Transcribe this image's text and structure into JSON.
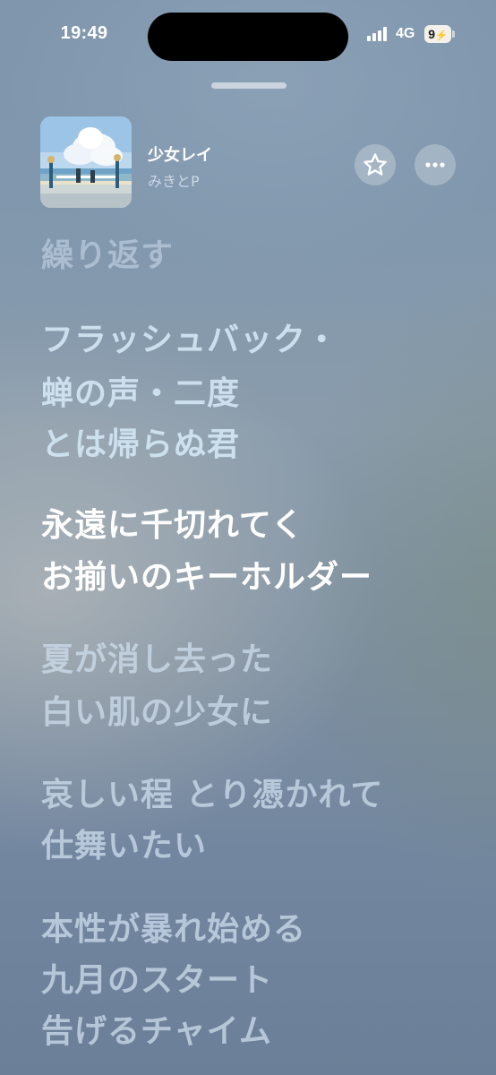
{
  "status_bar": {
    "time": "19:49",
    "network": "4G",
    "battery_level": "9",
    "signal_bars": 4,
    "icons": [
      "signal-icon",
      "battery-charging-icon"
    ]
  },
  "now_playing": {
    "title": "少女レイ",
    "artist": "みきとP",
    "album_art_icon": "album-art-summer-sky-icon",
    "favorite_icon": "star-icon",
    "more_icon": "ellipsis-icon"
  },
  "lyrics": {
    "lines": [
      "繰り返す",
      "フラッシュバック・",
      "蝉の声・二度",
      "とは帰らぬ君",
      "永遠に千切れてく",
      "お揃いのキーホルダー",
      "夏が消し去った",
      "白い肌の少女に",
      "哀しい程 とり憑かれて",
      "仕舞いたい",
      "本性が暴れ始める",
      "九月のスタート",
      "告げるチャイム"
    ]
  },
  "colors": {
    "background_top": "#7f96ad",
    "background_bottom": "#6c7f98",
    "active_lyric": "#ffffff"
  }
}
